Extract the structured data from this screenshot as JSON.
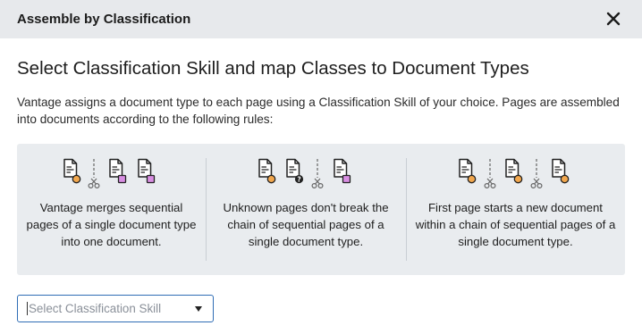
{
  "dialog": {
    "title": "Assemble by Classification",
    "close_icon": "close-icon"
  },
  "main": {
    "heading": "Select Classification Skill and map Classes to Document Types",
    "description": "Vantage assigns a document type to each page using a Classification Skill of your choice. Pages are assembled into documents according to the following rules:"
  },
  "rules": [
    {
      "text": "Vantage merges sequential pages of a single document type into one document.",
      "icons": [
        "document-orange-icon",
        "scissors-icon",
        "document-pink-icon",
        "document-pink-icon"
      ]
    },
    {
      "text": "Unknown pages don't break the chain of sequential pages of a single document type.",
      "icons": [
        "document-orange-icon",
        "document-unknown-icon",
        "scissors-icon",
        "document-pink-icon"
      ]
    },
    {
      "text": "First page starts a new document within a chain of sequential pages of a single document type.",
      "icons": [
        "document-orange-icon",
        "scissors-icon",
        "document-orange-icon",
        "scissors-icon",
        "document-orange-icon"
      ]
    }
  ],
  "skill_select": {
    "placeholder": "Select Classification Skill",
    "arrow_icon": "caret-down-icon"
  },
  "colors": {
    "header_bg": "#e7e9ec",
    "panel_bg": "#e9ecef",
    "orange_marker": "#f2a74d",
    "pink_marker": "#d98ee3",
    "select_border": "#2f6db5"
  }
}
